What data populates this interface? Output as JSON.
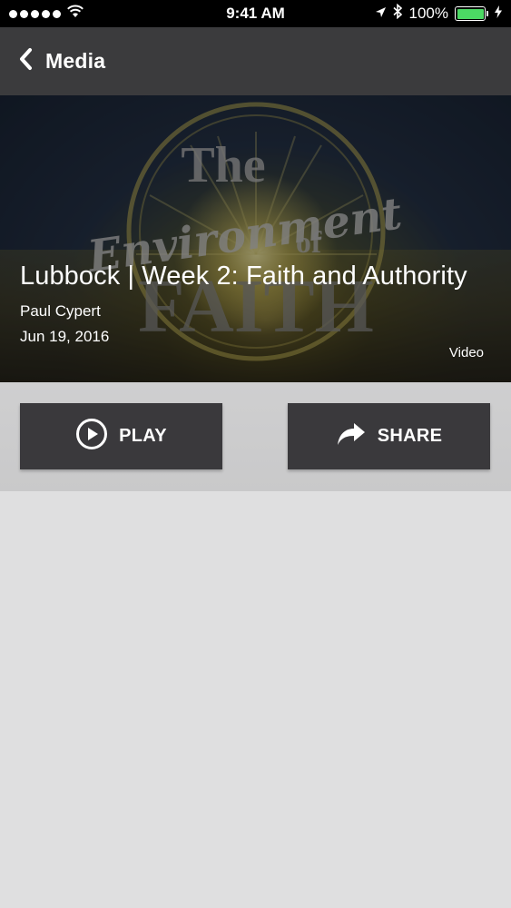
{
  "status_bar": {
    "time": "9:41 AM",
    "battery_percent": "100%",
    "battery_level": 1.0,
    "icons": [
      "signal-dots-icon",
      "wifi-icon",
      "location-arrow-icon",
      "bluetooth-icon",
      "battery-icon",
      "charging-bolt-icon"
    ]
  },
  "nav": {
    "back_label": "Media",
    "back_icon": "chevron-left-icon"
  },
  "hero": {
    "artwork_text": [
      "The",
      "Environment",
      "of",
      "FAITH"
    ],
    "title": "Lubbock | Week 2: Faith and Authority",
    "author": "Paul Cypert",
    "date": "Jun 19, 2016",
    "media_type": "Video"
  },
  "actions": {
    "play_label": "PLAY",
    "play_icon": "play-circle-icon",
    "share_label": "SHARE",
    "share_icon": "share-arrow-icon"
  },
  "colors": {
    "nav_bg": "#3b3b3d",
    "button_bg": "#3a393c",
    "page_bg": "#dfdfe0",
    "battery_green": "#4cd964"
  }
}
